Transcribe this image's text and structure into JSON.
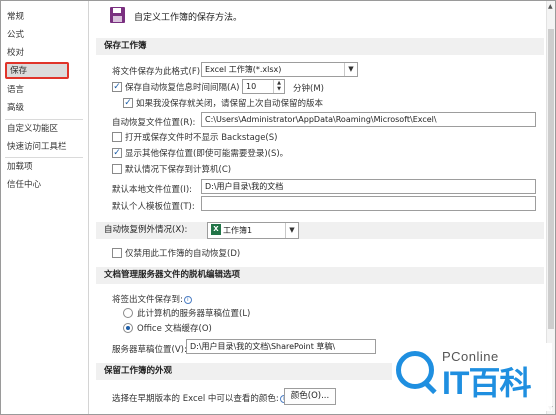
{
  "sidebar": {
    "items": [
      {
        "label": "常规"
      },
      {
        "label": "公式"
      },
      {
        "label": "校对"
      },
      {
        "label": "保存",
        "active": true
      },
      {
        "label": "语言"
      },
      {
        "label": "高级"
      },
      {
        "label": "自定义功能区"
      },
      {
        "label": "快速访问工具栏"
      },
      {
        "label": "加载项"
      },
      {
        "label": "信任中心"
      }
    ]
  },
  "main": {
    "intro": "自定义工作簿的保存方法。",
    "save_section": {
      "title": "保存工作簿",
      "format_label": "将文件保存为此格式(F):",
      "format_value": "Excel 工作簿(*.xlsx)",
      "autorecover_label": "保存自动恢复信息时间间隔(A)",
      "autorecover_checked": true,
      "autorecover_minutes": "10",
      "minutes_label": "分钟(M)",
      "keep_last_label": "如果我没保存就关闭，请保留上次自动保留的版本",
      "keep_last_checked": true,
      "autorecover_location_label": "自动恢复文件位置(R):",
      "autorecover_location_value": "C:\\Users\\Administrator\\AppData\\Roaming\\Microsoft\\Excel\\",
      "no_backstage_label": "打开或保存文件时不显示 Backstage(S)",
      "no_backstage_checked": false,
      "show_more_label": "显示其他保存位置(即使可能需要登录)(S)。",
      "show_more_checked": true,
      "default_local_label": "默认情况下保存到计算机(C)",
      "default_local_checked": false,
      "default_local_location_label": "默认本地文件位置(I):",
      "default_local_location_value": "D:\\用户目录\\我的文档",
      "template_location_label": "默认个人模板位置(T):",
      "template_location_value": ""
    },
    "exceptions": {
      "label": "自动恢复例外情况(X):",
      "workbook_icon": "X",
      "workbook": "工作簿1",
      "disable_label": "仅禁用此工作簿的自动恢复(D)",
      "disable_checked": false
    },
    "offline": {
      "title": "文档管理服务器文件的脱机编辑选项",
      "save_to_label": "将签出文件保存到:",
      "option_server": "此计算机的服务器草稿位置(L)",
      "option_cache": "Office 文档缓存(O)",
      "selected": "option_cache",
      "drafts_label": "服务器草稿位置(V):",
      "drafts_value": "D:\\用户目录\\我的文档\\SharePoint 草稿\\"
    },
    "appearance": {
      "title": "保留工作簿的外观",
      "colors_label": "选择在早期版本的 Excel 中可以查看的颜色:",
      "colors_button": "颜色(O)..."
    }
  },
  "watermark": {
    "pconline": "PConline",
    "brand": "IT百科"
  }
}
